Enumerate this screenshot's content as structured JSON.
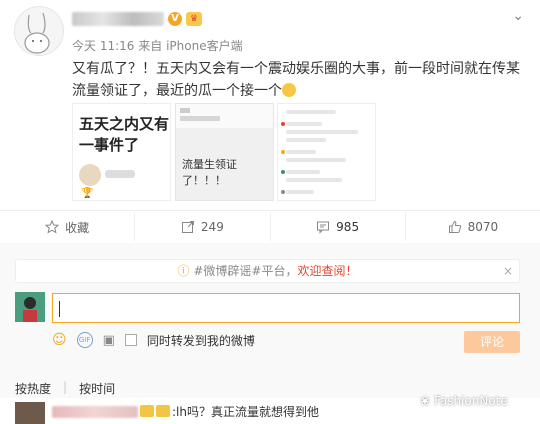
{
  "post": {
    "time": "今天 11:16",
    "source_prefix": "来自",
    "source": "iPhone客户端",
    "content": "又有瓜了？！五天内又会有一个震动娱乐圈的大事，前一段时间就在传某流量领证了，最近的瓜一个接一个"
  },
  "thumbnails": {
    "first_text": "五天之内又有一事件了",
    "second_text": "流量生领证了！！！"
  },
  "actions": {
    "favorite": "收藏",
    "repost": "249",
    "comment": "985",
    "like": "8070"
  },
  "banner": {
    "tag": "#微博辟谣#平台，",
    "warn": "欢迎查阅！",
    "close": "×"
  },
  "composer": {
    "placeholder": "",
    "repost_label": "同时转发到我的微博",
    "submit_label": "评论"
  },
  "sort": {
    "hot": "按热度",
    "time": "按时间"
  },
  "first_comment": {
    "text": ":lh吗？真正流量就想得到他"
  },
  "watermark": "FashionNote",
  "colors": {
    "accent": "#f5a623",
    "submit_disabled": "#fdc89c",
    "warn": "#e0462e"
  }
}
